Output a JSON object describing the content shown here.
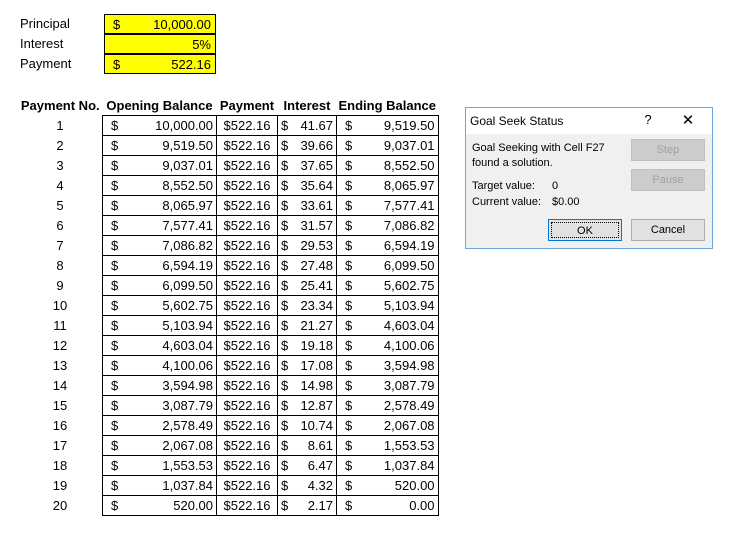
{
  "inputs": {
    "principal": {
      "label": "Principal",
      "currency": "$",
      "value": "10,000.00"
    },
    "interest": {
      "label": "Interest",
      "value": "5%"
    },
    "payment": {
      "label": "Payment",
      "currency": "$",
      "value": "522.16"
    }
  },
  "table": {
    "headers": [
      "Payment No.",
      "Opening Balance",
      "Payment",
      "Interest",
      "Ending Balance"
    ],
    "currency": "$",
    "rows": [
      {
        "no": "1",
        "open": "10,000.00",
        "pay": "$522.16",
        "int": "41.67",
        "end": "9,519.50"
      },
      {
        "no": "2",
        "open": "9,519.50",
        "pay": "$522.16",
        "int": "39.66",
        "end": "9,037.01"
      },
      {
        "no": "3",
        "open": "9,037.01",
        "pay": "$522.16",
        "int": "37.65",
        "end": "8,552.50"
      },
      {
        "no": "4",
        "open": "8,552.50",
        "pay": "$522.16",
        "int": "35.64",
        "end": "8,065.97"
      },
      {
        "no": "5",
        "open": "8,065.97",
        "pay": "$522.16",
        "int": "33.61",
        "end": "7,577.41"
      },
      {
        "no": "6",
        "open": "7,577.41",
        "pay": "$522.16",
        "int": "31.57",
        "end": "7,086.82"
      },
      {
        "no": "7",
        "open": "7,086.82",
        "pay": "$522.16",
        "int": "29.53",
        "end": "6,594.19"
      },
      {
        "no": "8",
        "open": "6,594.19",
        "pay": "$522.16",
        "int": "27.48",
        "end": "6,099.50"
      },
      {
        "no": "9",
        "open": "6,099.50",
        "pay": "$522.16",
        "int": "25.41",
        "end": "5,602.75"
      },
      {
        "no": "10",
        "open": "5,602.75",
        "pay": "$522.16",
        "int": "23.34",
        "end": "5,103.94"
      },
      {
        "no": "11",
        "open": "5,103.94",
        "pay": "$522.16",
        "int": "21.27",
        "end": "4,603.04"
      },
      {
        "no": "12",
        "open": "4,603.04",
        "pay": "$522.16",
        "int": "19.18",
        "end": "4,100.06"
      },
      {
        "no": "13",
        "open": "4,100.06",
        "pay": "$522.16",
        "int": "17.08",
        "end": "3,594.98"
      },
      {
        "no": "14",
        "open": "3,594.98",
        "pay": "$522.16",
        "int": "14.98",
        "end": "3,087.79"
      },
      {
        "no": "15",
        "open": "3,087.79",
        "pay": "$522.16",
        "int": "12.87",
        "end": "2,578.49"
      },
      {
        "no": "16",
        "open": "2,578.49",
        "pay": "$522.16",
        "int": "10.74",
        "end": "2,067.08"
      },
      {
        "no": "17",
        "open": "2,067.08",
        "pay": "$522.16",
        "int": "8.61",
        "end": "1,553.53"
      },
      {
        "no": "18",
        "open": "1,553.53",
        "pay": "$522.16",
        "int": "6.47",
        "end": "1,037.84"
      },
      {
        "no": "19",
        "open": "1,037.84",
        "pay": "$522.16",
        "int": "4.32",
        "end": "520.00"
      },
      {
        "no": "20",
        "open": "520.00",
        "pay": "$522.16",
        "int": "2.17",
        "end": "0.00"
      }
    ]
  },
  "dialog": {
    "title": "Goal Seek Status",
    "help": "?",
    "close": "✕",
    "message": "Goal Seeking with Cell F27 found a solution.",
    "target_label": "Target value:",
    "target_value": "0",
    "current_label": "Current value:",
    "current_value": "$0.00",
    "step_label": "Step",
    "pause_label": "Pause",
    "ok_label": "OK",
    "cancel_label": "Cancel"
  },
  "colors": {
    "input_fill": "#ffff00",
    "dialog_border": "#6ea5d9",
    "dialog_bg": "#f0f0f0"
  }
}
